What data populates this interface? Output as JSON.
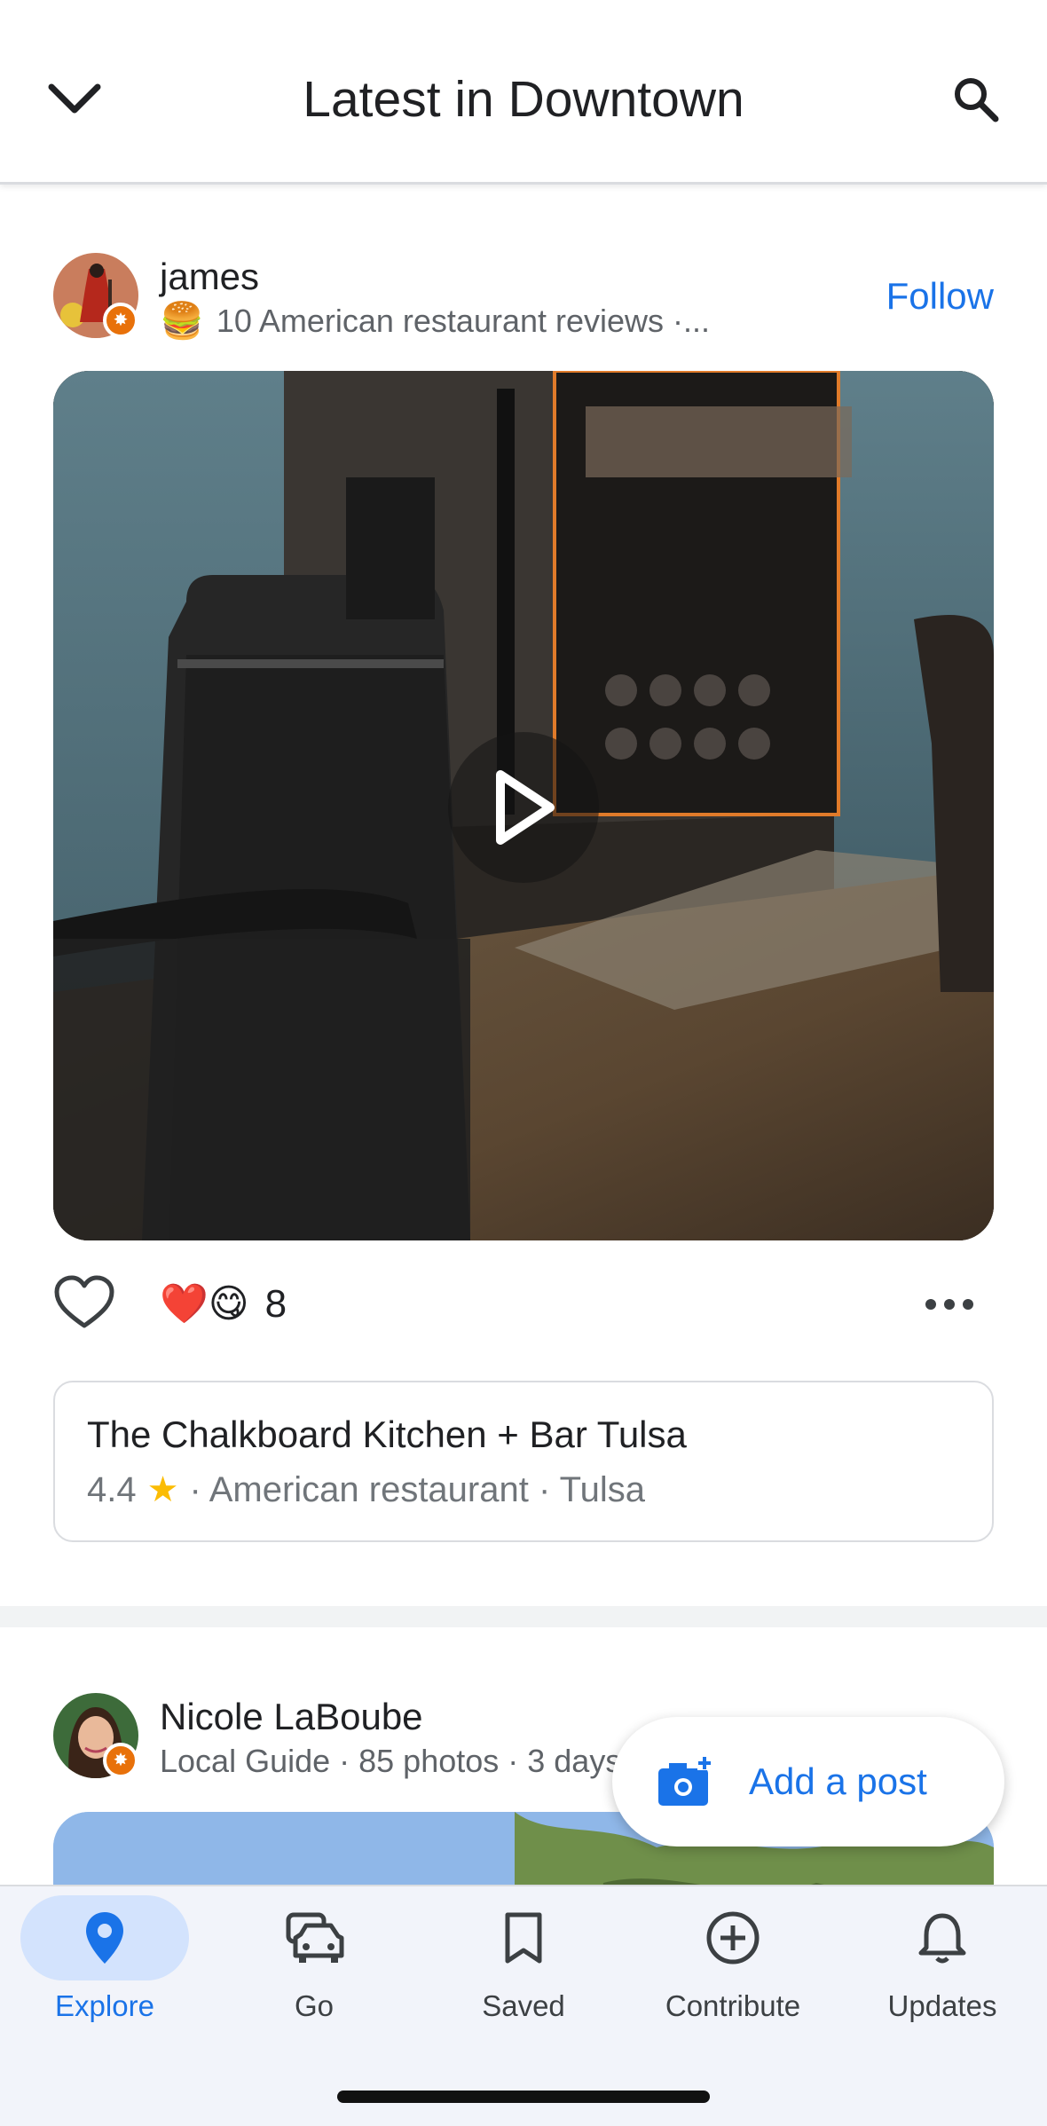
{
  "header": {
    "title": "Latest in Downtown"
  },
  "post1": {
    "author": "james",
    "meta_emoji": "🍔",
    "meta": "10 American restaurant reviews ·...",
    "follow_label": "Follow",
    "reaction_emojis": "❤️😋",
    "reaction_count": "8",
    "more_label": "•••",
    "place": {
      "name": "The Chalkboard Kitchen + Bar Tulsa",
      "rating": "4.4",
      "star": "★",
      "details": "· American restaurant · Tulsa"
    }
  },
  "post2": {
    "author": "Nicole LaBoube",
    "meta": "Local Guide · 85 photos · 3 days"
  },
  "fab": {
    "label": "Add a post"
  },
  "nav": {
    "items": [
      {
        "label": "Explore",
        "icon": "location-pin-icon",
        "active": true
      },
      {
        "label": "Go",
        "icon": "car-icon",
        "active": false
      },
      {
        "label": "Saved",
        "icon": "bookmark-icon",
        "active": false
      },
      {
        "label": "Contribute",
        "icon": "add-circle-icon",
        "active": false
      },
      {
        "label": "Updates",
        "icon": "bell-icon",
        "active": false
      }
    ]
  },
  "colors": {
    "accent": "#1a73e8",
    "nav_active_bg": "#d3e3fd",
    "star": "#fbbc04",
    "badge": "#e8710a"
  }
}
